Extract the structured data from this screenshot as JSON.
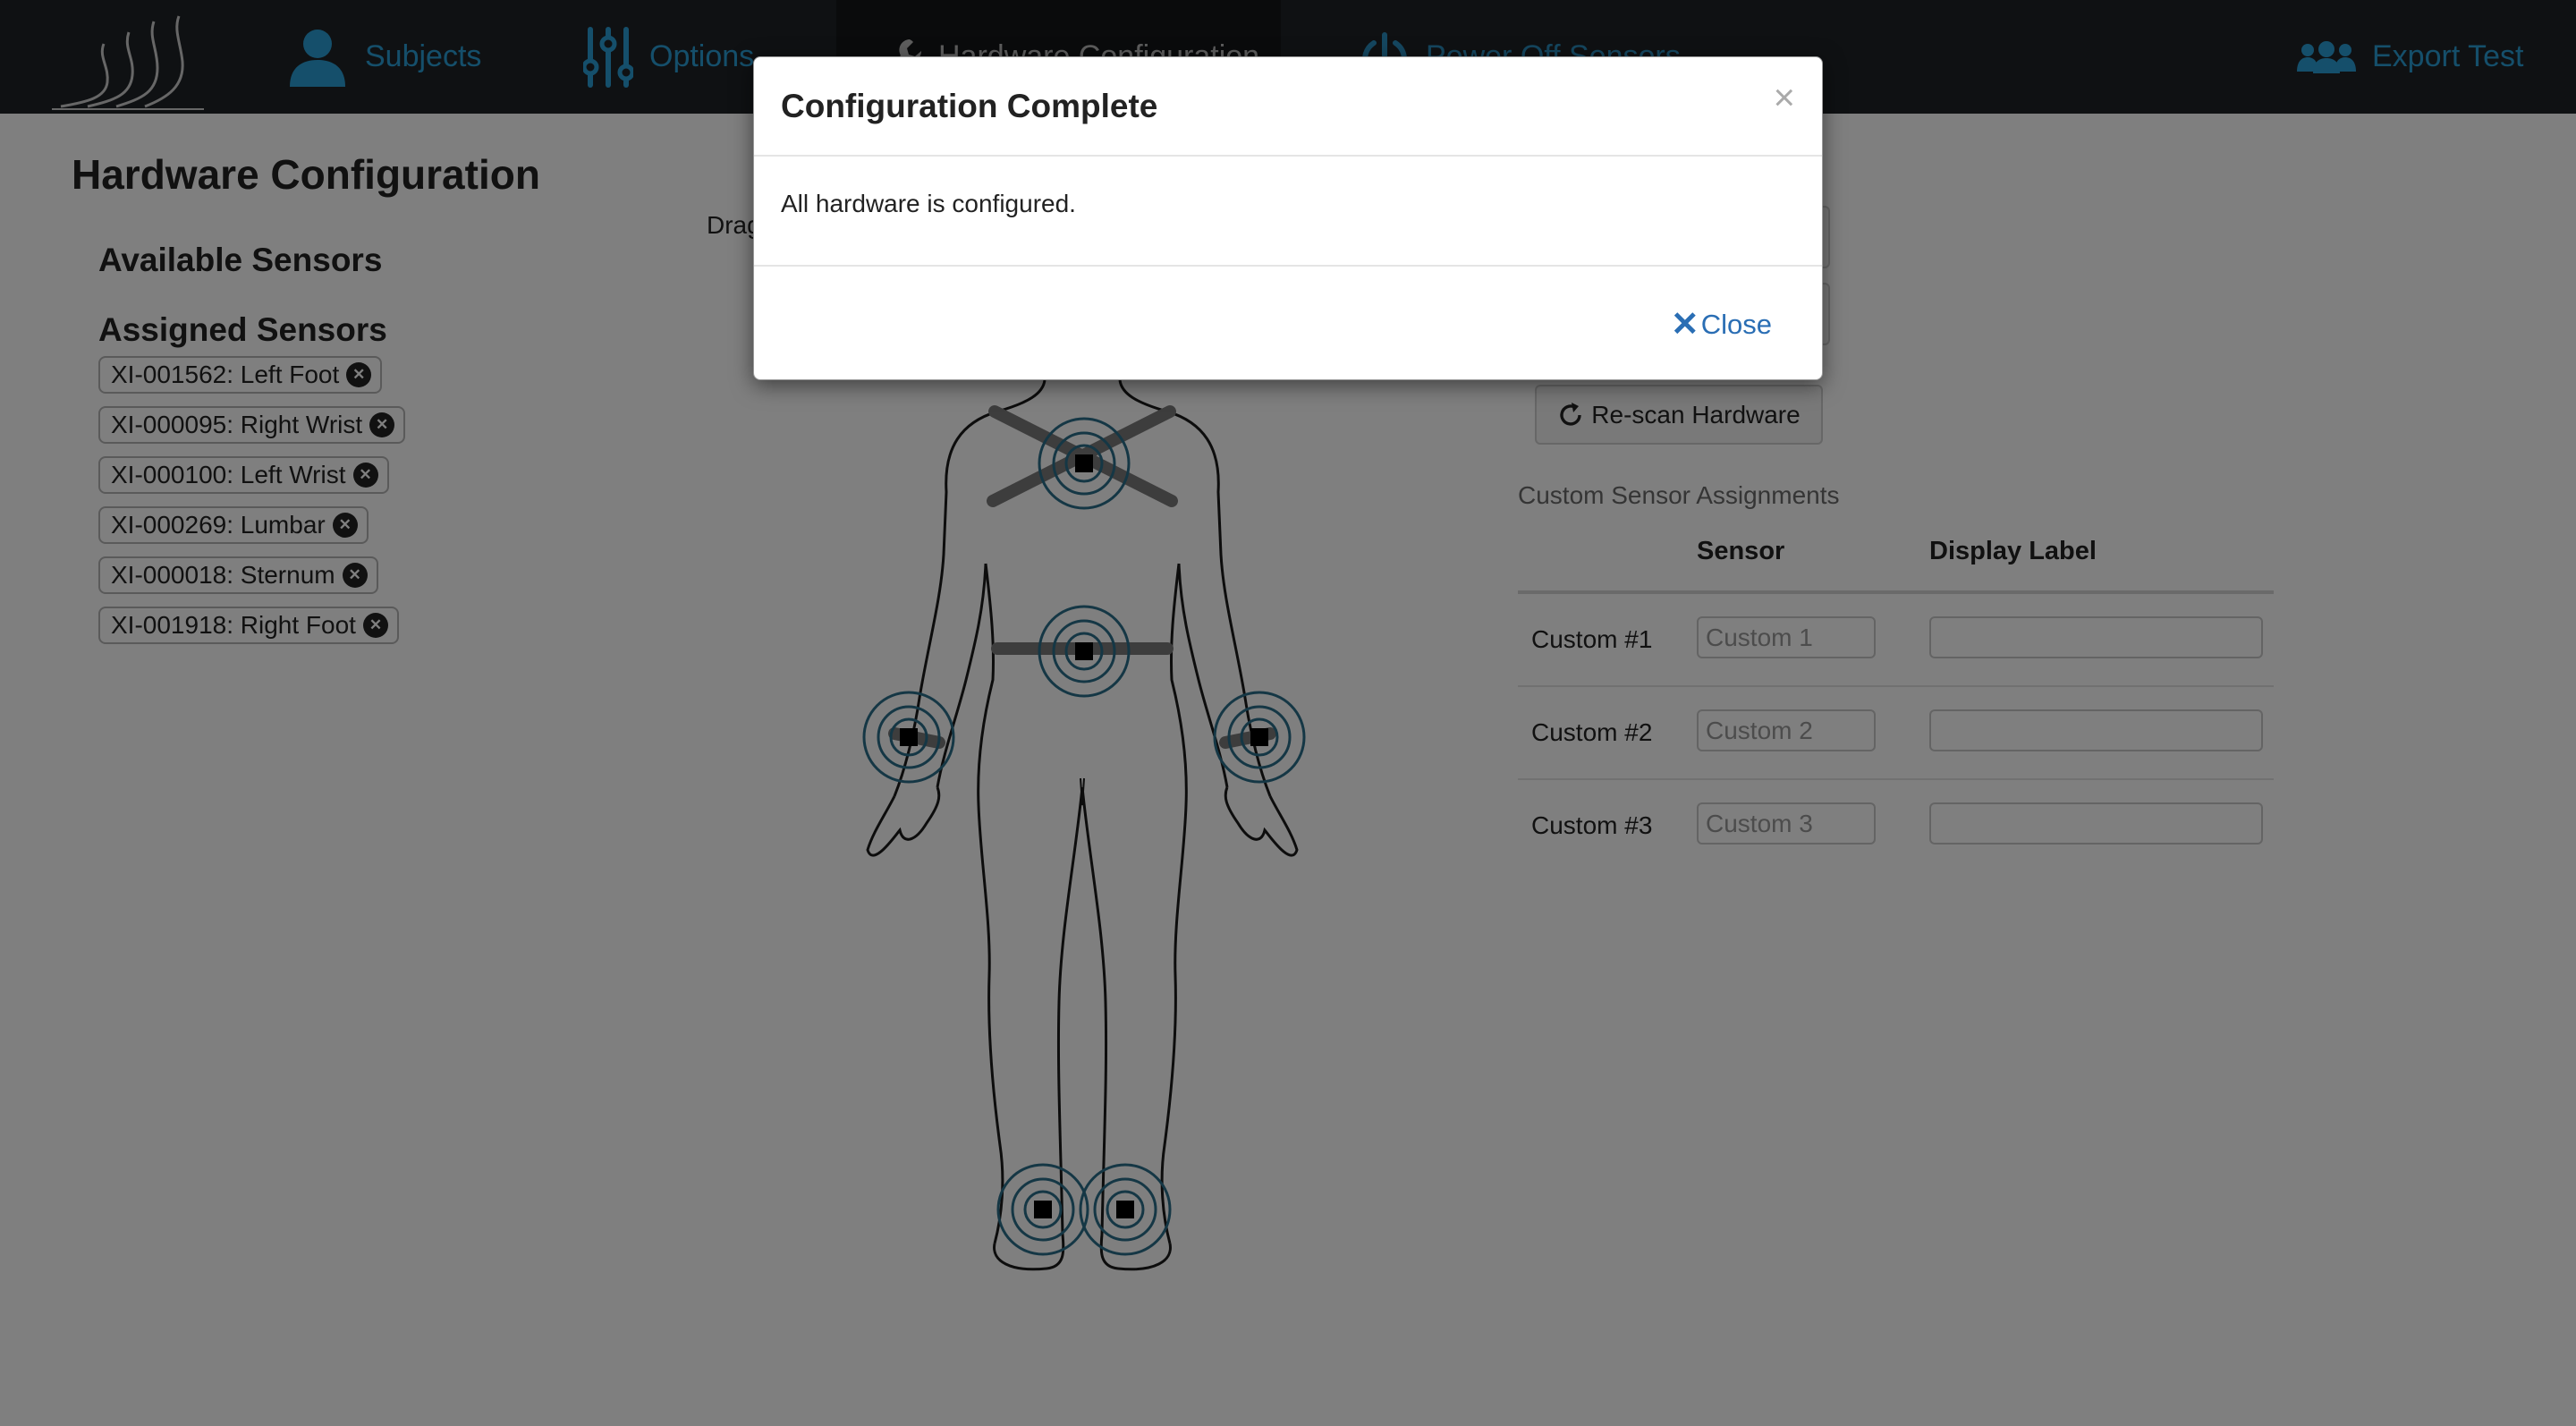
{
  "nav": {
    "items": [
      {
        "label": "Subjects",
        "icon": "user-icon"
      },
      {
        "label": "Options",
        "icon": "sliders-icon"
      },
      {
        "label": "Hardware Configuration",
        "icon": "wrench-icon"
      },
      {
        "label": "Power Off Sensors",
        "icon": "power-icon"
      }
    ],
    "export_label": "Export Test"
  },
  "page": {
    "title": "Hardware Configuration",
    "available_title": "Available Sensors",
    "assigned_title": "Assigned Sensors",
    "drag_hint": "Drag",
    "assigned_sensors": [
      "XI-001562: Left Foot",
      "XI-000095: Right Wrist",
      "XI-000100: Left Wrist",
      "XI-000269: Lumbar",
      "XI-000018: Sternum",
      "XI-001918: Right Foot"
    ],
    "rescan_label": "Re-scan Hardware"
  },
  "custom": {
    "title": "Custom Sensor Assignments",
    "col_sensor": "Sensor",
    "col_display": "Display Label",
    "rows": [
      {
        "label": "Custom #1",
        "placeholder": "Custom 1"
      },
      {
        "label": "Custom #2",
        "placeholder": "Custom 2"
      },
      {
        "label": "Custom #3",
        "placeholder": "Custom 3"
      }
    ]
  },
  "modal": {
    "title": "Configuration Complete",
    "close_x": "×",
    "body": "All hardware is configured.",
    "close_label": "Close"
  },
  "colors": {
    "navbar": "#1f2326",
    "nav_link": "#2a9fd6",
    "sensor_ring": "#2a6e8a"
  }
}
